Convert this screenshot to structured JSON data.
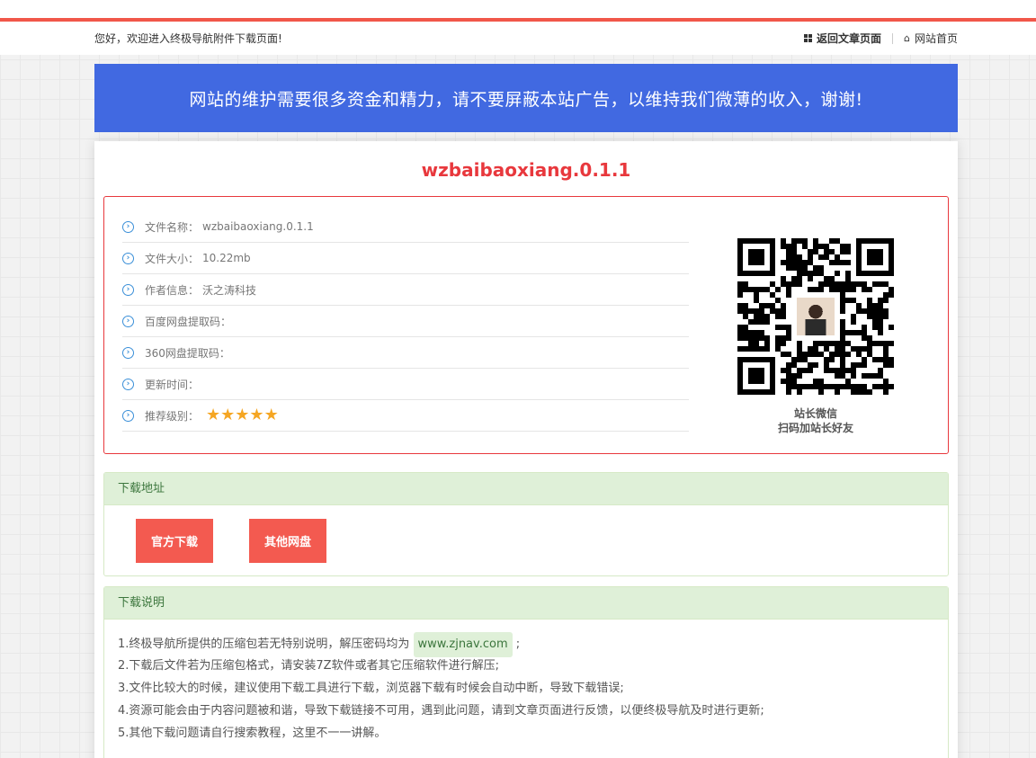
{
  "header": {
    "welcome": "您好，欢迎进入终极导航附件下载页面!",
    "back_link": "返回文章页面",
    "home_link": "网站首页"
  },
  "banner": {
    "text": "网站的维护需要很多资金和精力，请不要屏蔽本站广告，以维持我们微薄的收入，谢谢!"
  },
  "file": {
    "title": "wzbaibaoxiang.0.1.1",
    "info": [
      {
        "label": "文件名称：",
        "value": "wzbaibaoxiang.0.1.1"
      },
      {
        "label": "文件大小：",
        "value": "10.22mb"
      },
      {
        "label": "作者信息：",
        "value": "沃之涛科技"
      },
      {
        "label": "百度网盘提取码：",
        "value": ""
      },
      {
        "label": "360网盘提取码：",
        "value": ""
      },
      {
        "label": "更新时间：",
        "value": ""
      },
      {
        "label": "推荐级别：",
        "value": ""
      }
    ],
    "rating_stars": "★★★★★",
    "rating": 5
  },
  "qr": {
    "caption_line1": "站长微信",
    "caption_line2": "扫码加站长好友"
  },
  "download": {
    "heading": "下载地址",
    "official_button": "官方下载",
    "other_button": "其他网盘"
  },
  "notes": {
    "heading": "下载说明",
    "line1_before": "1.终极导航所提供的压缩包若无特别说明，解压密码均为",
    "password": "www.zjnav.com",
    "line1_after": ";",
    "line2": "2.下载后文件若为压缩包格式，请安装7Z软件或者其它压缩软件进行解压;",
    "line3": "3.文件比较大的时候，建议使用下载工具进行下载，浏览器下载有时候会自动中断，导致下载错误;",
    "line4": "4.资源可能会由于内容问题被和谐，导致下载链接不可用，遇到此问题，请到文章页面进行反馈，以便终极导航及时进行更新;",
    "line5": "5.其他下载问题请自行搜索教程，这里不一一讲解。"
  },
  "colors": {
    "accent_red": "#e8383d",
    "banner_blue": "#4169e1",
    "button_red": "#f35a50",
    "panel_green": "#dff0d8"
  },
  "icons": [
    "grid-icon",
    "home-icon",
    "chevron-circle-icon",
    "star-icon",
    "qr-code"
  ]
}
